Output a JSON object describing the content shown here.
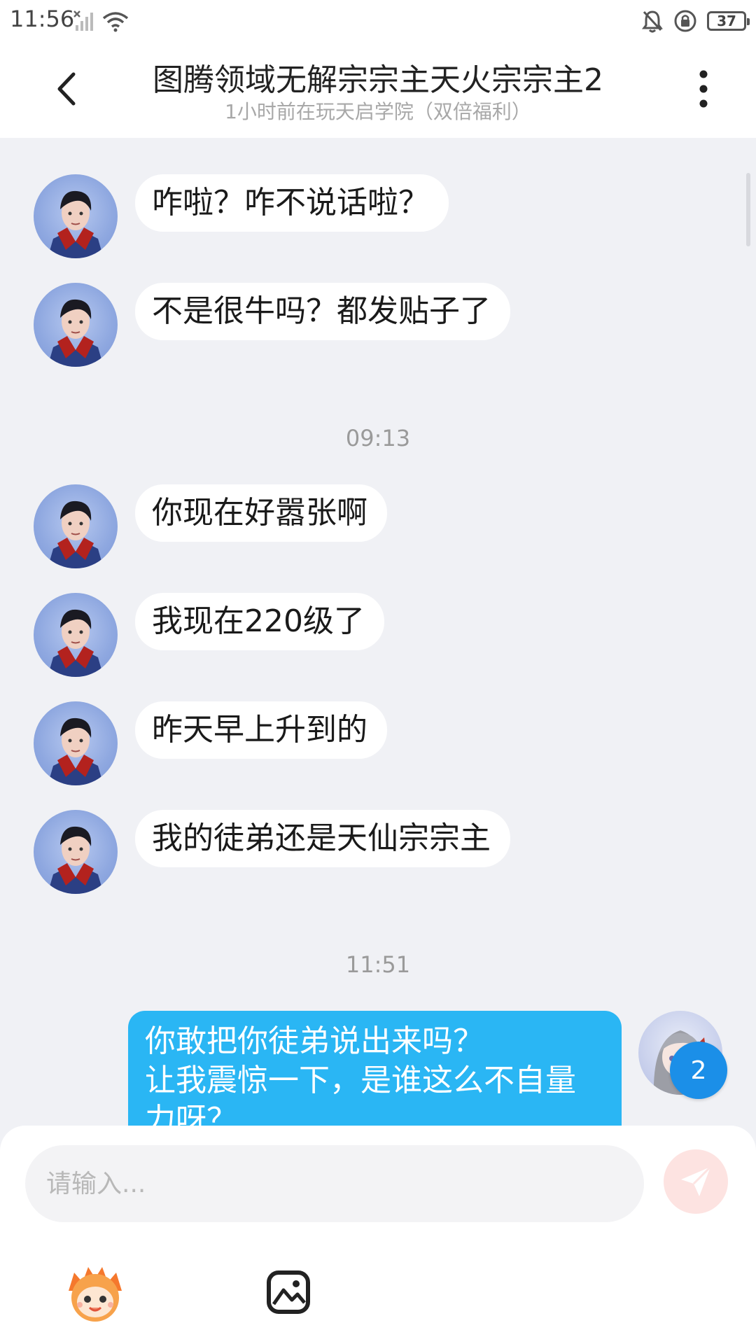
{
  "status_bar": {
    "time": "11:56",
    "battery": "37",
    "icons": [
      "signal-off-icon",
      "wifi-icon",
      "mute-bell-icon",
      "rotation-lock-icon",
      "battery-icon"
    ]
  },
  "header": {
    "title": "图腾领域无解宗宗主天火宗宗主2",
    "subtitle": "1小时前在玩天启学院（双倍福利）",
    "back_icon": "chevron-left-icon",
    "more_icon": "more-vertical-icon"
  },
  "conversation": {
    "incoming_group_1": [
      {
        "text": "咋啦？咋不说话啦？"
      },
      {
        "text": "不是很牛吗？都发贴子了"
      }
    ],
    "time_1": "09:13",
    "incoming_group_2": [
      {
        "text": "你现在好嚣张啊"
      },
      {
        "text": "我现在220级了"
      },
      {
        "text": "昨天早上升到的"
      },
      {
        "text": "我的徒弟还是天仙宗宗主"
      }
    ],
    "time_2": "11:51",
    "outgoing": {
      "lines": [
        "你敢把你徒弟说出来吗？",
        "让我震惊一下，是谁这么不自量",
        "力呀？"
      ],
      "badge_count": "2"
    }
  },
  "composer": {
    "placeholder": "请输入...",
    "send_icon": "send-icon",
    "emoji_icon": "emoji-mascot-icon",
    "image_icon": "image-icon"
  },
  "colors": {
    "outgoing_bubble": "#2ab6f4",
    "badge": "#1b8fe8",
    "send_button_bg": "#fde3e1",
    "background": "#f0f1f5"
  }
}
